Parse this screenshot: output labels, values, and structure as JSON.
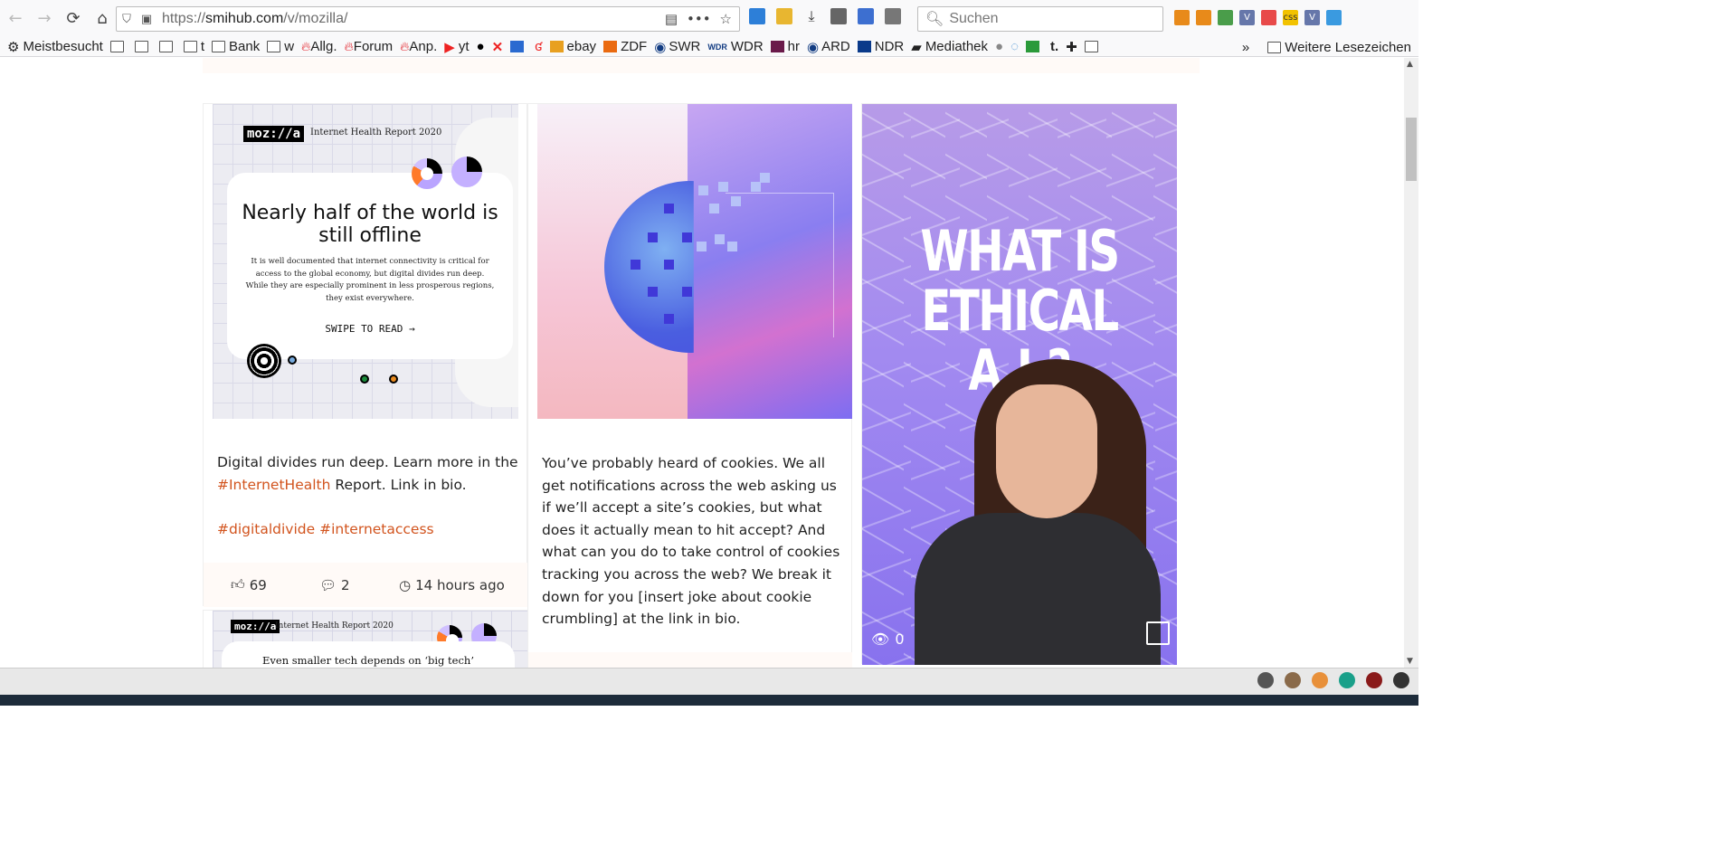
{
  "browser": {
    "url_prefix": "https://",
    "url_host": "smihub.com",
    "url_path": "/v/mozilla/",
    "search_placeholder": "Suchen"
  },
  "bookmarks": {
    "items": [
      "Meistbesucht",
      "",
      "",
      "",
      "t",
      "Bank",
      "w",
      "Allg.",
      "Forum",
      "Anp.",
      "yt",
      "",
      "",
      "",
      "",
      "ebay",
      "ZDF",
      "SWR",
      "WDR",
      "hr",
      "ARD",
      "NDR",
      "Mediathek"
    ],
    "more": "Weitere Lesezeichen"
  },
  "cards": [
    {
      "image": {
        "logo": "moz://a",
        "report": "Internet Health Report 2020",
        "headline": "Nearly half of the world is still offline",
        "body": "It is well documented that internet connectivity is critical for access to the global economy, but digital divides run deep. While they are especially prominent in less prosperous regions, they exist everywhere.",
        "cta": "SWIPE TO READ →"
      },
      "caption_a": "Digital divides run deep. Learn more in the ",
      "caption_tag1": "#InternetHealth",
      "caption_b": " Report. Link in bio.",
      "caption_tag2": "#digitaldivide",
      "caption_tag3": "#internetaccess",
      "likes": "69",
      "comments": "2",
      "time": "14 hours ago"
    },
    {
      "caption": "You’ve probably heard of cookies. We all get notifications across the web asking us if we’ll accept a site’s cookies, but what does it actually mean to hit accept? And what can you do to take control of cookies tracking you across the web? We break it down for you [insert joke about cookie crumbling] at the link in bio."
    },
    {
      "image_title": "WHAT IS ETHICAL A.I.?",
      "views": "0"
    },
    {
      "image": {
        "logo": "moz://a",
        "report": "Internet Health Report 2020",
        "headline": "Even smaller tech depends on ‘big tech’"
      }
    }
  ]
}
